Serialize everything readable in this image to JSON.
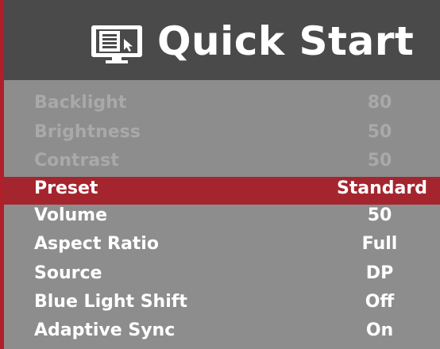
{
  "header": {
    "icon": "monitor-menu-icon",
    "title": "Quick Start"
  },
  "menu": {
    "items": [
      {
        "label": "Backlight",
        "value": "80",
        "state": "disabled"
      },
      {
        "label": "Brightness",
        "value": "50",
        "state": "disabled"
      },
      {
        "label": "Contrast",
        "value": "50",
        "state": "disabled"
      },
      {
        "label": "Preset",
        "value": "Standard",
        "state": "selected"
      },
      {
        "label": "Volume",
        "value": "50",
        "state": "enabled"
      },
      {
        "label": "Aspect Ratio",
        "value": "Full",
        "state": "enabled"
      },
      {
        "label": "Source",
        "value": "DP",
        "state": "enabled"
      },
      {
        "label": "Blue Light Shift",
        "value": "Off",
        "state": "enabled"
      },
      {
        "label": "Adaptive Sync",
        "value": "On",
        "state": "enabled"
      }
    ]
  },
  "colors": {
    "accent": "#a5252e",
    "panel": "#8d8d8d",
    "header": "#4a4a4a",
    "disabled_text": "#a9a9a9"
  }
}
